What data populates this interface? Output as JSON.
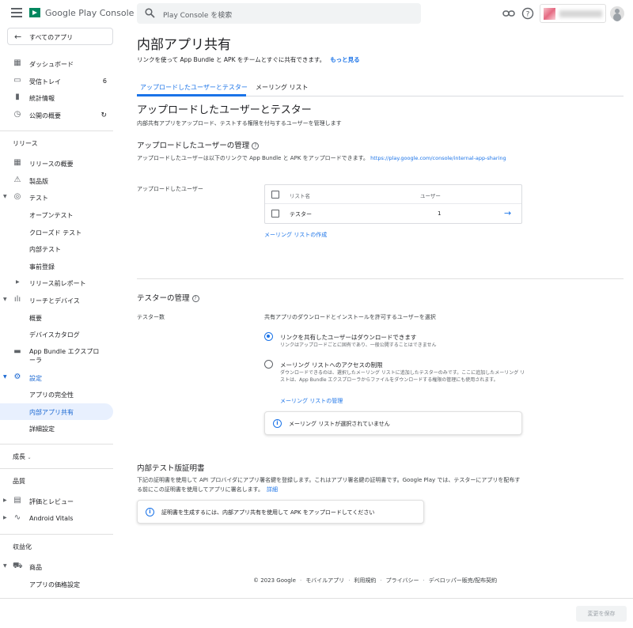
{
  "header": {
    "brand": "Google Play Console",
    "search_placeholder": "Play Console を検索"
  },
  "sidebar": {
    "back_label": "すべてのアプリ",
    "top_items": [
      {
        "label": "ダッシュボード",
        "icon": "dashboard-icon"
      },
      {
        "label": "受信トレイ",
        "icon": "inbox-icon",
        "badge": "6"
      },
      {
        "label": "統計情報",
        "icon": "bar-chart-icon"
      },
      {
        "label": "公開の概要",
        "icon": "publishing-icon"
      }
    ],
    "release_section": "リリース",
    "release_items": [
      {
        "label": "リリースの概要"
      },
      {
        "label": "製品版"
      },
      {
        "label": "テスト"
      },
      {
        "label": "オープンテスト"
      },
      {
        "label": "クローズド テスト"
      },
      {
        "label": "内部テスト"
      },
      {
        "label": "事前登録"
      },
      {
        "label": "リリース前レポート"
      },
      {
        "label": "リーチとデバイス"
      },
      {
        "label": "概要"
      },
      {
        "label": "デバイスカタログ"
      },
      {
        "label": "App Bundle エクスプローラ"
      },
      {
        "label": "設定"
      },
      {
        "label": "アプリの完全性"
      },
      {
        "label": "内部アプリ共有"
      },
      {
        "label": "詳細設定"
      }
    ],
    "growth_section": "成長",
    "quality_section": "品質",
    "quality_items": [
      {
        "label": "評価とレビュー"
      },
      {
        "label": "Android Vitals"
      }
    ],
    "monetize_section": "収益化",
    "monetize_items": [
      {
        "label": "商品"
      },
      {
        "label": "アプリの価格設定"
      }
    ]
  },
  "main": {
    "title": "内部アプリ共有",
    "subtitle": "リンクを使って App Bundle と APK をチームとすぐに共有できます。",
    "learn_more": "もっと見る",
    "tabs": [
      {
        "label": "アップロードしたユーザーとテスター"
      },
      {
        "label": "メーリング リスト"
      }
    ],
    "section1": {
      "title": "アップロードしたユーザーとテスター",
      "desc": "内部共有アプリをアップロード、テストする権限を付与するユーザーを管理します"
    },
    "uploaders": {
      "title": "アップロードしたユーザーの管理",
      "desc": "アップロードしたユーザーは以下のリンクで App Bundle と APK をアップロードできます。",
      "url": "https://play.google.com/console/internal-app-sharing",
      "field_label": "アップロードしたユーザー",
      "col_list": "リスト名",
      "col_users": "ユーザー",
      "rows": [
        {
          "name": "テスター",
          "users": "1"
        }
      ],
      "create_list": "メーリング リストの作成"
    },
    "testers": {
      "title": "テスターの管理",
      "field_label": "テスター数",
      "field_desc": "共有アプリのダウンロードとインストールを許可するユーザーを選択",
      "opt1_title": "リンクを共有したユーザーはダウンロードできます",
      "opt1_desc": "リンクはアップロードごとに固有であり、一般公開することはできません",
      "opt2_title": "メーリング リストへのアクセスの制限",
      "opt2_desc": "ダウンロードできるのは、選択したメーリング リストに追加したテスターのみです。ここに追加したメーリング リストは、App Bundle エクスプローラからファイルをダウンロードする権限の管理にも使用されます。",
      "opt2_link": "メーリング リストの管理",
      "no_list_info": "メーリング リストが選択されていません"
    },
    "cert": {
      "title": "内部テスト版証明書",
      "desc": "下記の証明書を使用して API プロバイダにアプリ署名鍵を登録します。これはアプリ署名鍵の証明書です。Google Play では、テスターにアプリを配布する前にこの証明書を使用してアプリに署名します。",
      "details": "詳細",
      "info": "証明書を生成するには、内部アプリ共有を使用して APK をアップロードしてください"
    }
  },
  "footer": {
    "copyright": "© 2023 Google",
    "links": [
      "モバイルアプリ",
      "利用規約",
      "プライバシー",
      "デベロッパー販売/配布契約"
    ]
  },
  "actions": {
    "save": "変更を保存"
  },
  "colors": {
    "accent": "#1a73e8",
    "active_bg": "#e8f0fe"
  }
}
